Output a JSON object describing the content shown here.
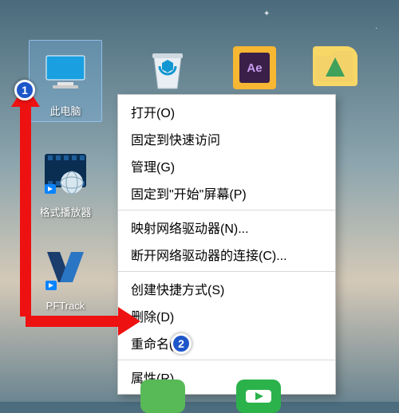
{
  "icons": {
    "this_pc": "此电脑",
    "recycle_bin": "回收站",
    "player": "格式播放器",
    "pftrack": "PFTrack"
  },
  "context_menu": {
    "open": "打开(O)",
    "pin_quick_access": "固定到快速访问",
    "manage": "管理(G)",
    "pin_start": "固定到\"开始\"屏幕(P)",
    "map_drive": "映射网络驱动器(N)...",
    "disconnect_drive": "断开网络驱动器的连接(C)...",
    "create_shortcut": "创建快捷方式(S)",
    "delete": "删除(D)",
    "rename": "重命名(M)",
    "properties": "属性(R)"
  },
  "badges": {
    "one": "1",
    "two": "2"
  }
}
